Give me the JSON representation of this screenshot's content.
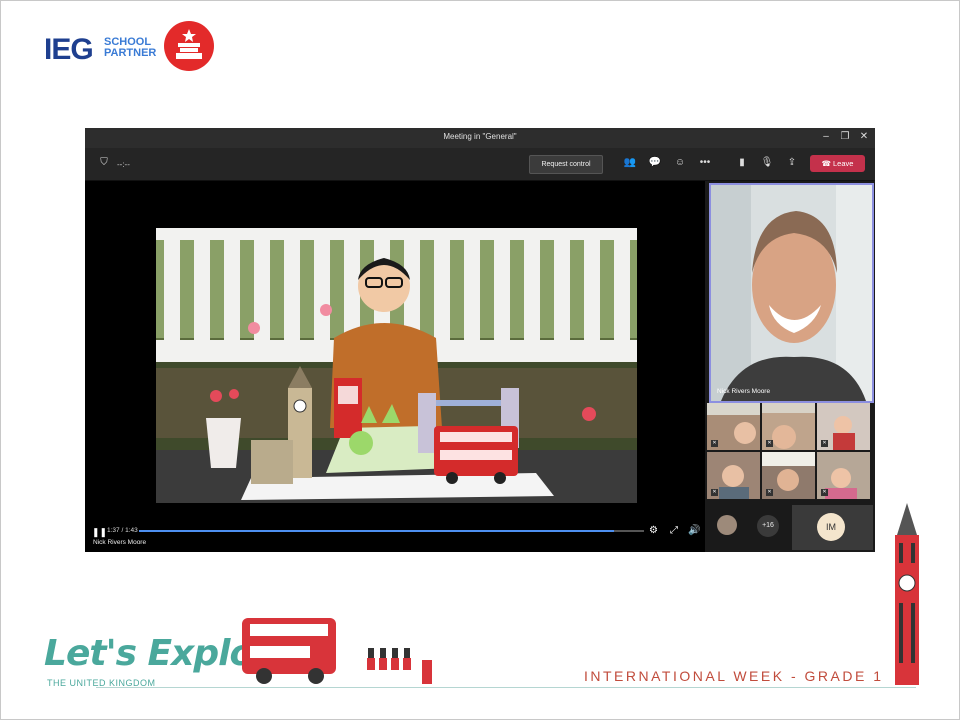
{
  "logos": {
    "ieg": "IEG",
    "ieg_sub_1": "SCHOOL",
    "ieg_sub_2": "PARTNER"
  },
  "window": {
    "title": "Meeting in \"General\"",
    "timer": "--:--",
    "request_control": "Request control",
    "leave": "Leave"
  },
  "video": {
    "time": "1:37 / 1:43",
    "progress": 0.94,
    "presenter": "Nick Rivers Moore"
  },
  "participants": {
    "main_name": "Nick Rivers Moore",
    "more_count": "+16",
    "initials": "IM"
  },
  "footer": {
    "brand": "Let's Explore",
    "brand_sub": "THE UNITED KINGDOM",
    "week": "INTERNATIONAL WEEK - GRADE 1"
  },
  "colors": {
    "accent": "#c4314b",
    "brand": "#4aa89c",
    "highlight": "#8c8fe0"
  }
}
